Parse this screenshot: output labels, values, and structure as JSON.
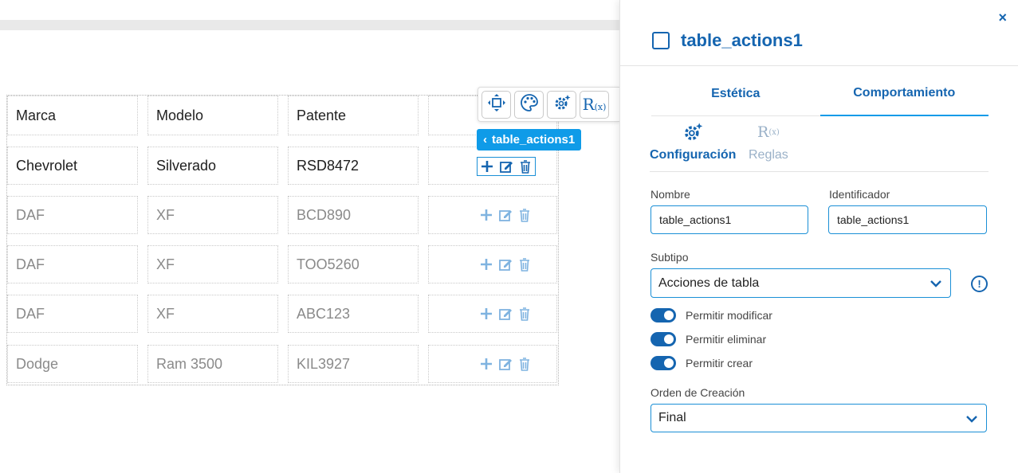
{
  "table": {
    "headers": [
      "Marca",
      "Modelo",
      "Patente"
    ],
    "rows": [
      {
        "marca": "Chevrolet",
        "modelo": "Silverado",
        "patente": "RSD8472"
      },
      {
        "marca": "DAF",
        "modelo": "XF",
        "patente": "BCD890"
      },
      {
        "marca": "DAF",
        "modelo": "XF",
        "patente": "TOO5260"
      },
      {
        "marca": "DAF",
        "modelo": "XF",
        "patente": "ABC123"
      },
      {
        "marca": "Dodge",
        "modelo": "Ram 3500",
        "patente": "KIL3927"
      }
    ]
  },
  "toolbar": {
    "icons": [
      "move-icon",
      "palette-icon",
      "gear-sparkle-icon",
      "rules-icon"
    ],
    "rules_glyph": "R",
    "rules_sub": "(x)"
  },
  "badge": {
    "label": "table_actions1"
  },
  "panel": {
    "close": "×",
    "title": "table_actions1",
    "tabs": [
      {
        "label": "Estética"
      },
      {
        "label": "Comportamiento"
      }
    ],
    "subtabs": [
      {
        "label": "Configuración"
      },
      {
        "label": "Reglas"
      }
    ],
    "nombre": {
      "label": "Nombre",
      "value": "table_actions1"
    },
    "identificador": {
      "label": "Identificador",
      "value": "table_actions1"
    },
    "subtipo": {
      "label": "Subtipo",
      "value": "Acciones de tabla"
    },
    "info_icon": "!",
    "toggles": [
      {
        "label": "Permitir modificar",
        "on": true
      },
      {
        "label": "Permitir eliminar",
        "on": true
      },
      {
        "label": "Permitir crear",
        "on": true
      }
    ],
    "orden": {
      "label": "Orden de Creación",
      "value": "Final"
    }
  },
  "colors": {
    "primary": "#1565b0",
    "accent": "#0f9be8",
    "action_dim": "#7fb3e0"
  }
}
